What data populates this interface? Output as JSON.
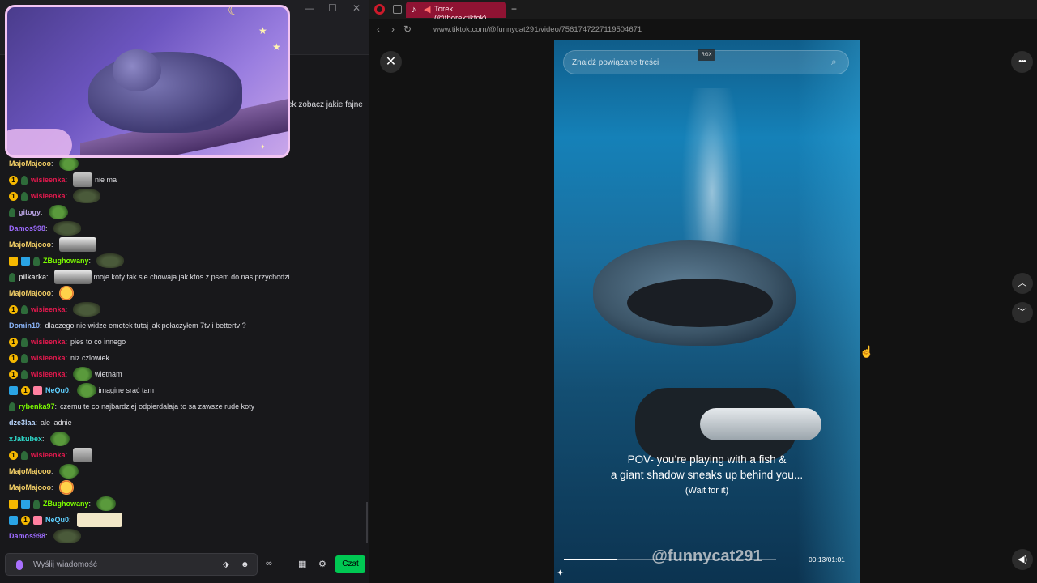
{
  "window_controls": {
    "minimize": "—",
    "maximize": "☐",
    "close": "✕"
  },
  "webcam": {
    "decor": {
      "moon": "☾",
      "star": "★",
      "small_star": "✦"
    }
  },
  "chat": {
    "partial_line": "ek zobacz jakie fajne",
    "messages": [
      {
        "badges": [],
        "user": "MajoMajooo",
        "color": "#f5d066",
        "text": "",
        "emotes": [
          "pepe"
        ]
      },
      {
        "badges": [
          "coin",
          "sprout"
        ],
        "user": "wisieenka",
        "color": "#e5184e",
        "text": "nie ma",
        "emotes": [
          "face"
        ]
      },
      {
        "badges": [
          "coin",
          "sprout"
        ],
        "user": "wisieenka",
        "color": "#e5184e",
        "text": "",
        "emotes": [
          "toad"
        ]
      },
      {
        "badges": [
          "sprout"
        ],
        "user": "gitogy",
        "color": "#b9a3e3",
        "text": "",
        "emotes": [
          "pepe"
        ]
      },
      {
        "badges": [],
        "user": "Damos998",
        "color": "#9d6bff",
        "text": "",
        "emotes": [
          "toad"
        ]
      },
      {
        "badges": [],
        "user": "MajoMajooo",
        "color": "#f5d066",
        "text": "",
        "emotes": [
          "wide"
        ]
      },
      {
        "badges": [
          "crown",
          "prime",
          "sprout"
        ],
        "user": "ZBughowany",
        "color": "#7cfc00",
        "text": "",
        "emotes": [
          "toad"
        ]
      },
      {
        "badges": [
          "sprout"
        ],
        "user": "pilkarka",
        "color": "#cfcfcf",
        "text": "moje koty tak sie chowaja jak ktos z psem do nas przychodzi",
        "emotes": [
          "wide"
        ]
      },
      {
        "badges": [],
        "user": "MajoMajooo",
        "color": "#f5d066",
        "text": "",
        "emotes": [
          "laugh"
        ]
      },
      {
        "badges": [
          "coin",
          "sprout"
        ],
        "user": "wisieenka",
        "color": "#e5184e",
        "text": "",
        "emotes": [
          "toad"
        ]
      },
      {
        "badges": [],
        "user": "Domin10",
        "color": "#8ab4f8",
        "text": "dlaczego nie widze emotek tutaj jak połaczyłem 7tv i bettertv ?",
        "emotes": []
      },
      {
        "badges": [
          "coin",
          "sprout"
        ],
        "user": "wisieenka",
        "color": "#e5184e",
        "text": "pies to co innego",
        "emotes": []
      },
      {
        "badges": [
          "coin",
          "sprout"
        ],
        "user": "wisieenka",
        "color": "#e5184e",
        "text": "niz czlowiek",
        "emotes": []
      },
      {
        "badges": [
          "coin",
          "sprout"
        ],
        "user": "wisieenka",
        "color": "#e5184e",
        "text": "wietnam",
        "emotes": [
          "pepe"
        ]
      },
      {
        "badges": [
          "prime",
          "coin",
          "gift"
        ],
        "user": "NeQu0",
        "color": "#5fd0ff",
        "text": "imagine srać tam",
        "emotes": [
          "pepe"
        ]
      },
      {
        "badges": [
          "sprout"
        ],
        "user": "rybenka97",
        "color": "#7cfc00",
        "text": "czemu te co najbardziej odpierdalaja to sa zawsze rude koty",
        "emotes": []
      },
      {
        "badges": [],
        "user": "dze3laa",
        "color": "#b9d7ff",
        "text": "ale ladnie",
        "emotes": []
      },
      {
        "badges": [],
        "user": "xJakubex",
        "color": "#2fe0d0",
        "text": "",
        "emotes": [
          "pepe"
        ]
      },
      {
        "badges": [
          "coin",
          "sprout"
        ],
        "user": "wisieenka",
        "color": "#e5184e",
        "text": "",
        "emotes": [
          "face"
        ]
      },
      {
        "badges": [],
        "user": "MajoMajooo",
        "color": "#f5d066",
        "text": "",
        "emotes": [
          "pepe"
        ]
      },
      {
        "badges": [],
        "user": "MajoMajooo",
        "color": "#f5d066",
        "text": "",
        "emotes": [
          "laugh"
        ]
      },
      {
        "badges": [
          "crown",
          "prime",
          "sprout"
        ],
        "user": "ZBughowany",
        "color": "#7cfc00",
        "text": "",
        "emotes": [
          "pepe"
        ]
      },
      {
        "badges": [
          "prime",
          "coin",
          "gift"
        ],
        "user": "NeQu0",
        "color": "#5fd0ff",
        "text": "",
        "emotes": [
          "cream"
        ]
      },
      {
        "badges": [],
        "user": "Damos998",
        "color": "#9d6bff",
        "text": "",
        "emotes": [
          "toad"
        ]
      }
    ],
    "badge_glyphs": {
      "coin": "1"
    },
    "input": {
      "placeholder": "Wyślij wiadomość",
      "bits_icon": "⬗",
      "emoji_icon": "☻",
      "channel_points_icon": "∞",
      "store_icon": "▦",
      "settings_icon": "⚙",
      "send_label": "Czat"
    }
  },
  "browser": {
    "tab": {
      "title": "Torek (@thorektiktok)",
      "tiktok_icon": "♪",
      "audio_icon": "◀",
      "new_tab": "+"
    },
    "nav": {
      "back": "‹",
      "forward": "›",
      "reload": "↻"
    },
    "url": "www.tiktok.com/@funnycat291/video/7561747227119504671",
    "video": {
      "search_placeholder": "Znajdź powiązane treści",
      "search_icon": "⌕",
      "rgx_badge": "RGX",
      "caption_line1": "POV- you’re playing with a fish &",
      "caption_line2": "a giant shadow sneaks up behind you...",
      "caption_line3": "(Wait for it)",
      "watermark": "@funnycat291",
      "time": "00:13/01:01",
      "progress": 0.25,
      "sparkle_icon": "✦"
    },
    "controls": {
      "close": "✕",
      "more": "•••",
      "up": "︿",
      "down": "﹀",
      "volume": "◀)",
      "cursor": "☝"
    }
  }
}
